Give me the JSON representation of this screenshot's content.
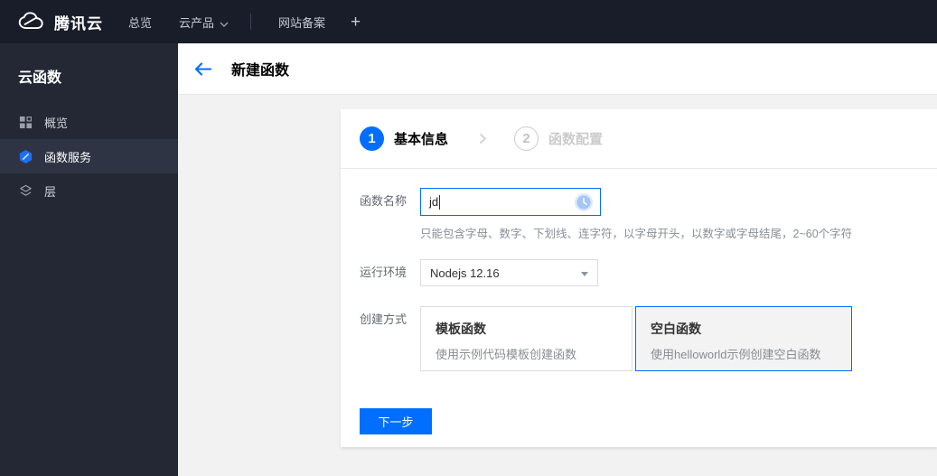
{
  "topnav": {
    "brand": "腾讯云",
    "items": [
      {
        "label": "总览"
      },
      {
        "label": "云产品"
      },
      {
        "label": "网站备案"
      }
    ],
    "plus": "+"
  },
  "sidebar": {
    "title": "云函数",
    "items": [
      {
        "label": "概览",
        "icon": "grid-icon",
        "selected": false
      },
      {
        "label": "函数服务",
        "icon": "function-hexagon-icon",
        "selected": true
      },
      {
        "label": "层",
        "icon": "layers-icon",
        "selected": false
      }
    ]
  },
  "header": {
    "title": "新建函数"
  },
  "wizard": {
    "steps": [
      {
        "number": "1",
        "label": "基本信息",
        "active": true
      },
      {
        "number": "2",
        "label": "函数配置",
        "active": false
      }
    ]
  },
  "form": {
    "name_field": {
      "label": "函数名称",
      "value": "jd",
      "helper": "只能包含字母、数字、下划线、连字符，以字母开头，以数字或字母结尾，2~60个字符"
    },
    "runtime_field": {
      "label": "运行环境",
      "value": "Nodejs 12.16"
    },
    "method_field": {
      "label": "创建方式",
      "options": [
        {
          "title": "模板函数",
          "desc": "使用示例代码模板创建函数",
          "selected": false
        },
        {
          "title": "空白函数",
          "desc": "使用helloworld示例创建空白函数",
          "selected": true
        }
      ]
    },
    "next_button": "下一步"
  },
  "colors": {
    "accent": "#006eff",
    "topnav_bg": "#181d29",
    "sidebar_bg": "#232834",
    "sidebar_selected_bg": "#2e3444",
    "content_bg": "#f2f2f2",
    "inactive_step": "#cccccc"
  }
}
